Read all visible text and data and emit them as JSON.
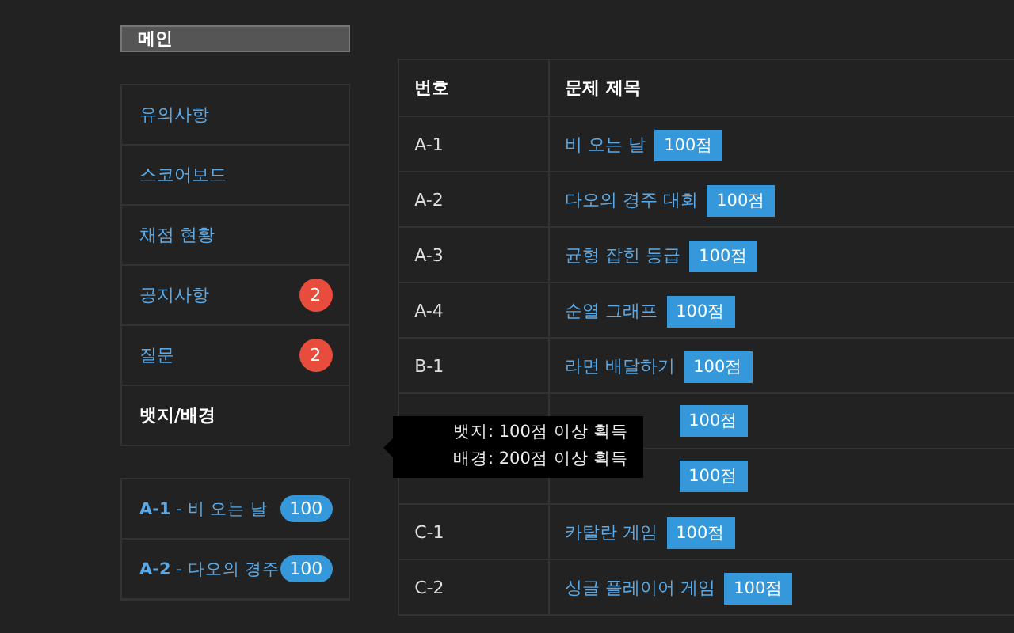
{
  "main_button": {
    "label": "메인"
  },
  "menu": [
    {
      "label": "유의사항",
      "selected": false
    },
    {
      "label": "스코어보드",
      "selected": false
    },
    {
      "label": "채점 현황",
      "selected": false
    },
    {
      "label": "공지사항",
      "selected": false,
      "count": "2"
    },
    {
      "label": "질문",
      "selected": false,
      "count": "2"
    },
    {
      "label": "뱃지/배경",
      "selected": true
    }
  ],
  "tooltip": {
    "lines": [
      "뱃지: 100점 이상 획득",
      "배경: 200점 이상 획득"
    ]
  },
  "problem_list": [
    {
      "code": "A-1",
      "separator": "-",
      "title": "비 오는 날",
      "score": "100"
    },
    {
      "code": "A-2",
      "separator": "-",
      "title": "다오의 경주",
      "score": "100"
    }
  ],
  "table": {
    "columns": [
      "번호",
      "문제 제목"
    ],
    "rows": [
      {
        "number": "A-1",
        "title": "비 오는 날",
        "points": "100점"
      },
      {
        "number": "A-2",
        "title": "다오의 경주 대회",
        "points": "100점"
      },
      {
        "number": "A-3",
        "title": "균형 잡힌 등급",
        "points": "100점"
      },
      {
        "number": "A-4",
        "title": "순열 그래프",
        "points": "100점"
      },
      {
        "number": "B-1",
        "title": "라면 배달하기",
        "points": "100점"
      },
      {
        "points": "100점"
      },
      {
        "points": "100점"
      },
      {
        "number": "C-1",
        "title": "카탈란 게임",
        "points": "100점"
      },
      {
        "number": "C-2",
        "title": "싱글 플레이어 게임",
        "points": "100점"
      }
    ]
  }
}
